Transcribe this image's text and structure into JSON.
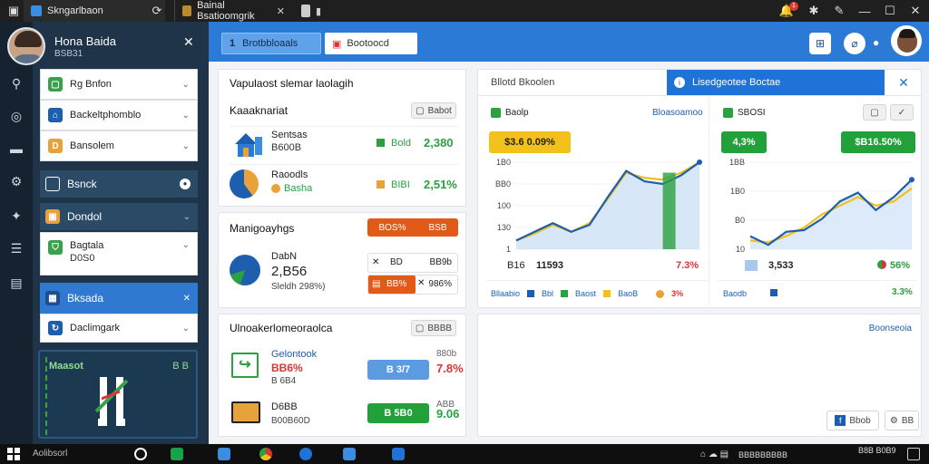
{
  "browser": {
    "tabs": [
      {
        "label": "Skngarlbaon"
      },
      {
        "label": "Bainal Bsatioomgrik"
      }
    ],
    "notification_count": "1"
  },
  "sidebar": {
    "user_name": "Hona Baida",
    "user_sub": "BSB31",
    "items": [
      {
        "label": "Rg Bnfon"
      },
      {
        "label": "Backeltphomblo"
      },
      {
        "label": "Bansolem"
      },
      {
        "label": "Bsnck"
      },
      {
        "label": "Dondol"
      },
      {
        "label": "Bagtala",
        "sub": "D0S0"
      },
      {
        "label": "Bksada"
      },
      {
        "label": "Daclimgark"
      }
    ],
    "promo": {
      "title": "Maasot",
      "value": "B B"
    }
  },
  "topbar": {
    "tab1": "Brotbbloaals",
    "tab2": "Bootoocd"
  },
  "card1": {
    "title": "Vapulaost slemar laolagih",
    "subtitle": "Kaaaknariat",
    "badge": "Babot",
    "rows": [
      {
        "name": "Sentsas",
        "sub": "B600B",
        "label": "Bold",
        "value": "2,380"
      },
      {
        "name": "Raoodls",
        "sub": "Basha",
        "label": "BIBI",
        "value": "2,51%"
      }
    ]
  },
  "card2": {
    "title": "Manigoayhgs",
    "btn1_label": "BOS%",
    "btn1_value": "BSB",
    "name": "DabN",
    "value": "2,B56",
    "sub": "Sleldh 298%)",
    "row1_label": "BD",
    "row1_value": "BB9b",
    "row2_label": "BB%",
    "row2_value": "986%"
  },
  "card3": {
    "title": "Ulnoakerlomeoraolca",
    "badge": "BBBB",
    "rows": [
      {
        "name": "Gelontook",
        "sub": "BB6%",
        "sub2": "B 6B4",
        "pill": "B 3/7",
        "value": "7.8%",
        "top": "880b"
      },
      {
        "name": "D6BB",
        "sub": "B00B60D",
        "pill": "B 5B0",
        "value": "9.06",
        "top": "ABB"
      }
    ]
  },
  "chart1": {
    "tab_label": "Bllotd Bkoolen",
    "badge_label": "Baolp",
    "value": "$3.6 0.09%",
    "side_label": "Bloasoamoo",
    "footer_l1": "B16",
    "footer_l2": "11593",
    "footer_r": "7.3%",
    "legend": [
      "Bllaabio",
      "Bbl",
      "Baost",
      "BaoB"
    ],
    "legend_value": "3%"
  },
  "chart2": {
    "header": "Lisedgeotee Boctae",
    "badge_label": "SBOSI",
    "value_left": "4,3%",
    "value_right": "$B16.50%",
    "footer_l": "3,533",
    "footer_r": "56%",
    "legend": "Baodb",
    "legend_value": "3.3%"
  },
  "bottom_panel": {
    "link": "Boonseoia",
    "btn1": "Bbob",
    "btn2": "BB"
  },
  "chart_data": [
    {
      "type": "area",
      "x": [
        "B16",
        "",
        "",
        "",
        "",
        "",
        "",
        "",
        "",
        "",
        "7.3%"
      ],
      "y_ticks": [
        "1B0",
        "BB0",
        "100",
        "130",
        "1"
      ],
      "ylim": [
        0,
        1
      ],
      "series": [
        {
          "values": [
            0.1,
            0.2,
            0.3,
            0.2,
            0.28,
            0.6,
            0.9,
            0.78,
            0.75,
            0.85,
            1.0
          ]
        },
        {
          "values": [
            0.1,
            0.18,
            0.28,
            0.2,
            0.3,
            0.58,
            0.88,
            0.82,
            0.8,
            0.88,
            1.0
          ]
        }
      ]
    },
    {
      "type": "area",
      "x": [
        "3,533",
        "",
        "",
        "",
        "",
        "",
        "",
        "",
        "",
        "56%"
      ],
      "y_ticks": [
        "1BB",
        "1B0",
        "B0",
        "10"
      ],
      "ylim": [
        0,
        1
      ],
      "series": [
        {
          "values": [
            0.15,
            0.05,
            0.2,
            0.22,
            0.35,
            0.55,
            0.65,
            0.45,
            0.6,
            0.8
          ]
        },
        {
          "values": [
            0.1,
            0.08,
            0.15,
            0.25,
            0.4,
            0.5,
            0.6,
            0.5,
            0.55,
            0.7
          ]
        }
      ]
    }
  ],
  "taskbar": {
    "search": "Aolibsorl",
    "clock": "BBBBBBBBB",
    "date": "B8B B0B9"
  }
}
